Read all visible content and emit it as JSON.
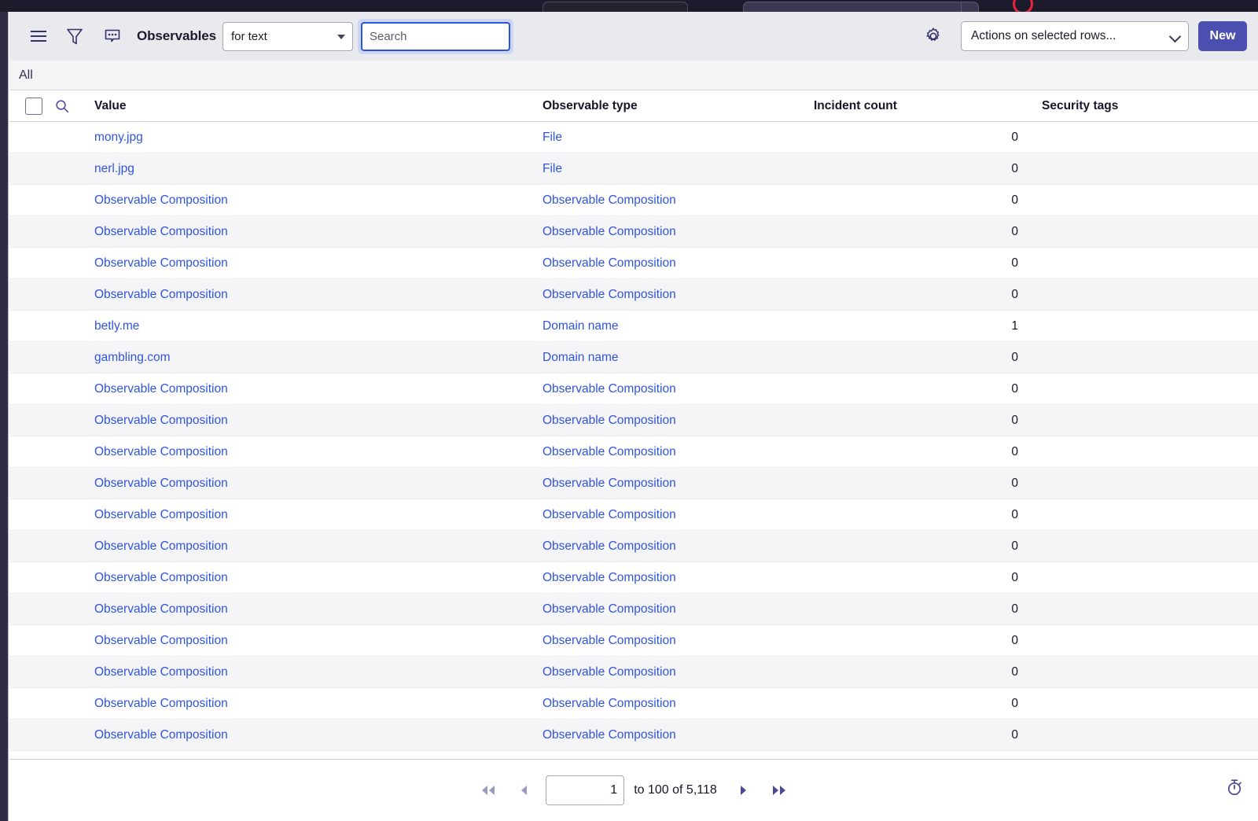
{
  "window": {
    "chrome_visible": true
  },
  "toolbar": {
    "menu_icon": "hamburger-menu-icon",
    "filter_icon": "filter-funnel-icon",
    "comment_icon": "comment-bubble-icon",
    "title": "Observables",
    "search_scope": {
      "value": "for text",
      "options": [
        "for text"
      ]
    },
    "search": {
      "value": "",
      "placeholder": "Search"
    },
    "settings_icon": "gear-icon",
    "actions": {
      "value": "Actions on selected rows...",
      "options": [
        "Actions on selected rows..."
      ]
    },
    "new_label": "New",
    "accent_color": "#4a4fb0"
  },
  "tabs": [
    {
      "label": "All",
      "active": true
    }
  ],
  "table": {
    "columns": [
      {
        "key": "select",
        "label": ""
      },
      {
        "key": "value",
        "label": "Value"
      },
      {
        "key": "type",
        "label": "Observable type"
      },
      {
        "key": "count",
        "label": "Incident count"
      },
      {
        "key": "tags",
        "label": "Security tags"
      }
    ],
    "link_color": "#2f55e0",
    "rows": [
      {
        "value": "mony.jpg",
        "type": "File",
        "count": "0",
        "tags": ""
      },
      {
        "value": "nerl.jpg",
        "type": "File",
        "count": "0",
        "tags": ""
      },
      {
        "value": "Observable Composition",
        "type": "Observable Composition",
        "count": "0",
        "tags": ""
      },
      {
        "value": "Observable Composition",
        "type": "Observable Composition",
        "count": "0",
        "tags": ""
      },
      {
        "value": "Observable Composition",
        "type": "Observable Composition",
        "count": "0",
        "tags": ""
      },
      {
        "value": "Observable Composition",
        "type": "Observable Composition",
        "count": "0",
        "tags": ""
      },
      {
        "value": "betly.me",
        "type": "Domain name",
        "count": "1",
        "tags": ""
      },
      {
        "value": "gambling.com",
        "type": "Domain name",
        "count": "0",
        "tags": ""
      },
      {
        "value": "Observable Composition",
        "type": "Observable Composition",
        "count": "0",
        "tags": ""
      },
      {
        "value": "Observable Composition",
        "type": "Observable Composition",
        "count": "0",
        "tags": ""
      },
      {
        "value": "Observable Composition",
        "type": "Observable Composition",
        "count": "0",
        "tags": ""
      },
      {
        "value": "Observable Composition",
        "type": "Observable Composition",
        "count": "0",
        "tags": ""
      },
      {
        "value": "Observable Composition",
        "type": "Observable Composition",
        "count": "0",
        "tags": ""
      },
      {
        "value": "Observable Composition",
        "type": "Observable Composition",
        "count": "0",
        "tags": ""
      },
      {
        "value": "Observable Composition",
        "type": "Observable Composition",
        "count": "0",
        "tags": ""
      },
      {
        "value": "Observable Composition",
        "type": "Observable Composition",
        "count": "0",
        "tags": ""
      },
      {
        "value": "Observable Composition",
        "type": "Observable Composition",
        "count": "0",
        "tags": ""
      },
      {
        "value": "Observable Composition",
        "type": "Observable Composition",
        "count": "0",
        "tags": ""
      },
      {
        "value": "Observable Composition",
        "type": "Observable Composition",
        "count": "0",
        "tags": ""
      },
      {
        "value": "Observable Composition",
        "type": "Observable Composition",
        "count": "0",
        "tags": ""
      }
    ]
  },
  "pagination": {
    "first_icon": "skip-to-first-icon",
    "prev_icon": "previous-page-icon",
    "page_value": "1",
    "range_label": "to 100 of 5,118",
    "next_icon": "next-page-icon",
    "last_icon": "skip-to-last-icon",
    "timer_icon": "stopwatch-icon"
  }
}
